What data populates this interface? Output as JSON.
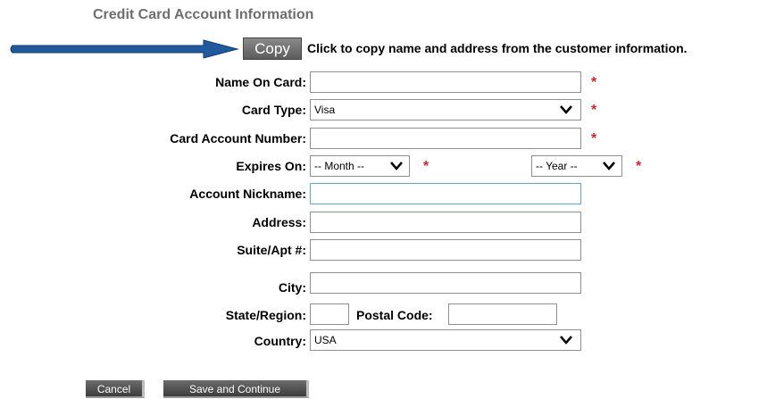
{
  "section_title": "Credit Card Account Information",
  "copy": {
    "button_label": "Copy",
    "note": "Click to copy name and address from the customer information."
  },
  "fields": {
    "name_on_card": {
      "label": "Name On Card:",
      "value": ""
    },
    "card_type": {
      "label": "Card Type:",
      "selected": "Visa"
    },
    "card_number": {
      "label": "Card Account Number:",
      "value": ""
    },
    "expires": {
      "label": "Expires On:",
      "month_selected": "-- Month --",
      "year_selected": "-- Year --"
    },
    "nickname": {
      "label": "Account Nickname:",
      "value": ""
    },
    "address": {
      "label": "Address:",
      "value": ""
    },
    "suite": {
      "label": "Suite/Apt #:",
      "value": ""
    },
    "city": {
      "label": "City:",
      "value": ""
    },
    "state": {
      "label": "State/Region:",
      "value": ""
    },
    "postal": {
      "label": "Postal Code:",
      "value": ""
    },
    "country": {
      "label": "Country:",
      "selected": "USA"
    }
  },
  "required_marker": "*",
  "buttons": {
    "cancel": "Cancel",
    "save": "Save and Continue"
  },
  "colors": {
    "arrow": "#1f5a9e",
    "required": "#e02020",
    "focus_border": "#5aa7e0"
  }
}
